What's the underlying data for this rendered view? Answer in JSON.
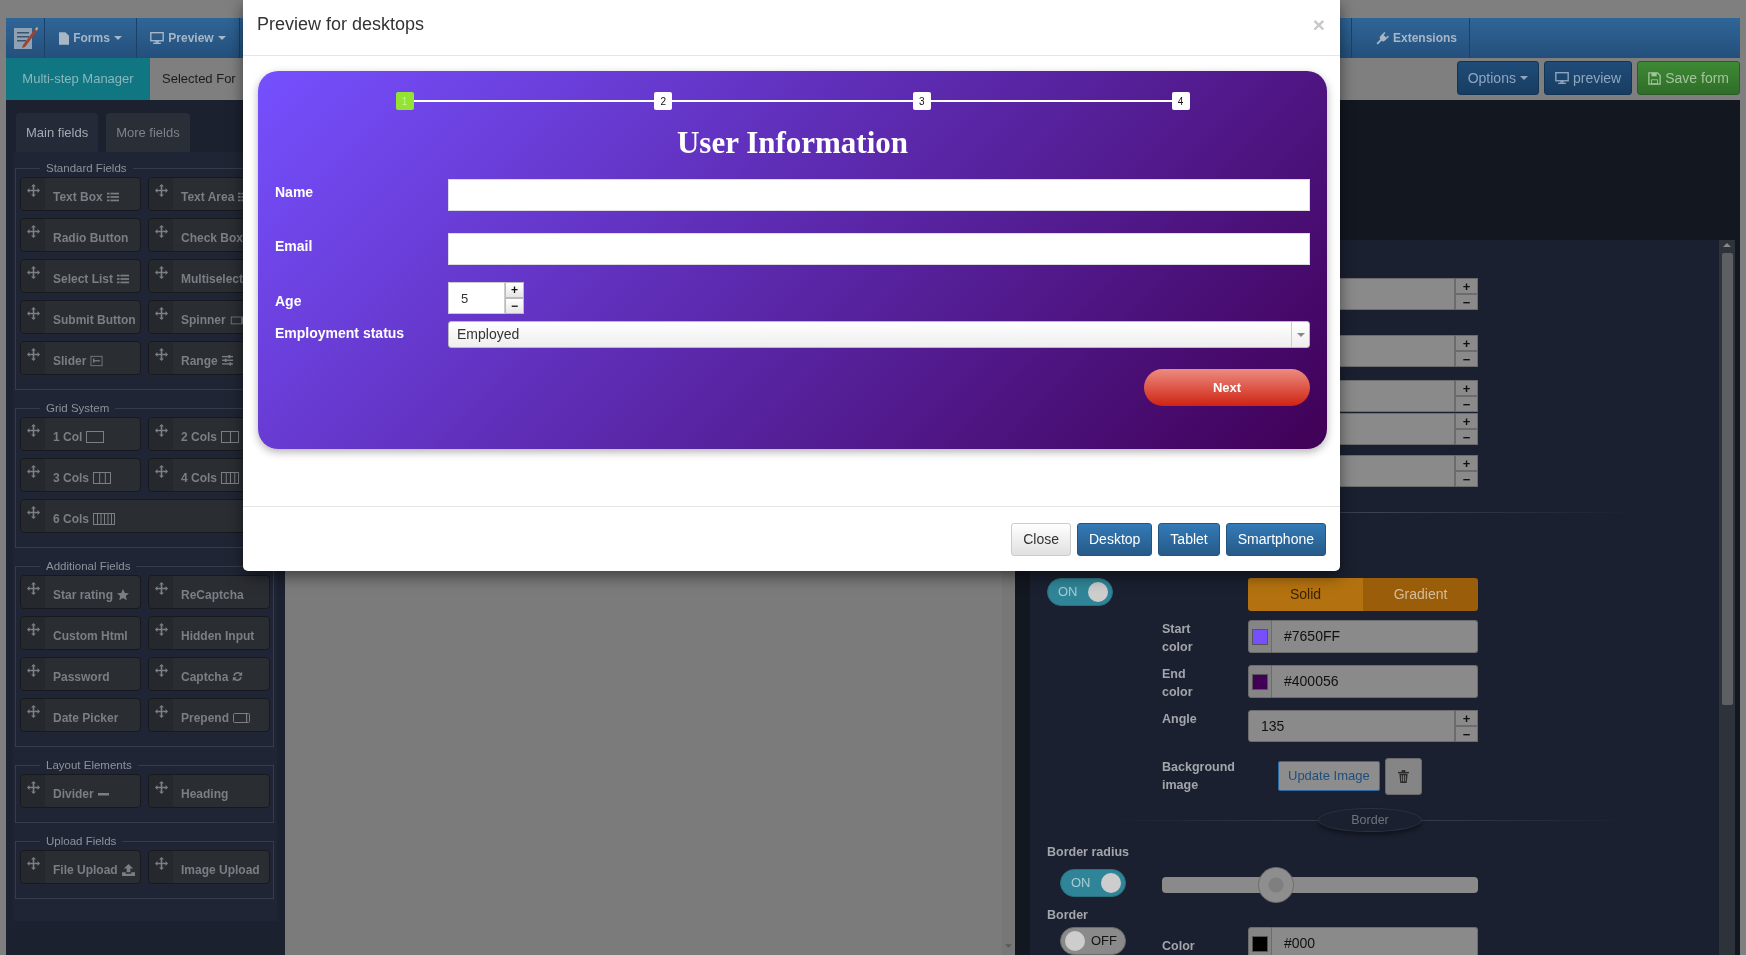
{
  "navbar": {
    "items": [
      {
        "label": "Forms",
        "dropdown": true
      },
      {
        "label": "Preview",
        "dropdown": true
      },
      {
        "label": "Extensions",
        "dropdown": false
      }
    ]
  },
  "subbar": {
    "tabs": [
      {
        "label": "Multi-step Manager",
        "selected": true
      },
      {
        "label": "Selected For",
        "selected": false
      }
    ],
    "buttons": [
      {
        "label": "Options",
        "dropdown": true,
        "kind": "primary"
      },
      {
        "label": "preview",
        "dropdown": false,
        "kind": "primary"
      },
      {
        "label": "Save form",
        "dropdown": false,
        "kind": "success"
      }
    ]
  },
  "sidebar": {
    "tabs": [
      {
        "label": "Main fields",
        "selected": true
      },
      {
        "label": "More fields",
        "selected": false
      }
    ],
    "groups": [
      {
        "legend": "Standard Fields",
        "items": [
          "Text Box",
          "Text Area",
          "Radio Button",
          "Check Box",
          "Select List",
          "Multiselect",
          "Submit Button",
          "Spinner",
          "Slider",
          "Range"
        ]
      },
      {
        "legend": "Grid System",
        "items": [
          "1 Col",
          "2 Cols",
          "3 Cols",
          "4 Cols",
          "6 Cols"
        ]
      },
      {
        "legend": "Additional Fields",
        "items": [
          "Star rating",
          "ReCaptcha",
          "Custom Html",
          "Hidden Input",
          "Password",
          "Captcha",
          "Date Picker",
          "Prepend"
        ]
      },
      {
        "legend": "Layout Elements",
        "items": [
          "Divider",
          "Heading"
        ]
      },
      {
        "legend": "Upload Fields",
        "items": [
          "File Upload",
          "Image Upload"
        ]
      }
    ]
  },
  "settings_panel": {
    "spinners": [
      {
        "plus": "+",
        "minus": "−"
      },
      {
        "plus": "+",
        "minus": "−"
      },
      {
        "plus": "+",
        "minus": "−"
      },
      {
        "plus": "+",
        "minus": "−"
      },
      {
        "plus": "+",
        "minus": "−"
      }
    ],
    "background_toggle": {
      "on": true,
      "text": "ON"
    },
    "fill_types": [
      {
        "label": "Solid",
        "selected": false
      },
      {
        "label": "Gradient",
        "selected": true
      }
    ],
    "start_color": {
      "label": "Start color",
      "value": "#7650FF"
    },
    "end_color": {
      "label": "End color",
      "value": "#400056"
    },
    "angle": {
      "label": "Angle",
      "value": "135",
      "plus": "+",
      "minus": "−"
    },
    "background_image": {
      "label": "Background image",
      "button": "Update Image"
    },
    "border_section": {
      "title": "Border"
    },
    "border_radius": {
      "label": "Border radius",
      "toggle": {
        "on": true,
        "text": "ON"
      },
      "level": 0.36
    },
    "border": {
      "label": "Border",
      "toggle": {
        "on": false,
        "text": "OFF"
      },
      "color_label": "Color",
      "color_value": "#000"
    }
  },
  "preview_modal": {
    "title": "Preview for desktops",
    "close": "×",
    "steps": [
      {
        "label": "1",
        "selected": true
      },
      {
        "label": "2",
        "selected": false
      },
      {
        "label": "3",
        "selected": false
      },
      {
        "label": "4",
        "selected": false
      }
    ],
    "heading": "User Information",
    "fields": [
      {
        "kind": "text",
        "label": "Name"
      },
      {
        "kind": "text",
        "label": "Email"
      },
      {
        "kind": "spinner",
        "label": "Age",
        "value": "5",
        "plus": "+",
        "minus": "−"
      },
      {
        "kind": "select",
        "label": "Employment status",
        "value": "Employed"
      }
    ],
    "next": "Next",
    "buttons": [
      {
        "label": "Close",
        "kind": "default"
      },
      {
        "label": "Desktop",
        "kind": "primary"
      },
      {
        "label": "Tablet",
        "kind": "primary"
      },
      {
        "label": "Smartphone",
        "kind": "primary"
      }
    ]
  }
}
